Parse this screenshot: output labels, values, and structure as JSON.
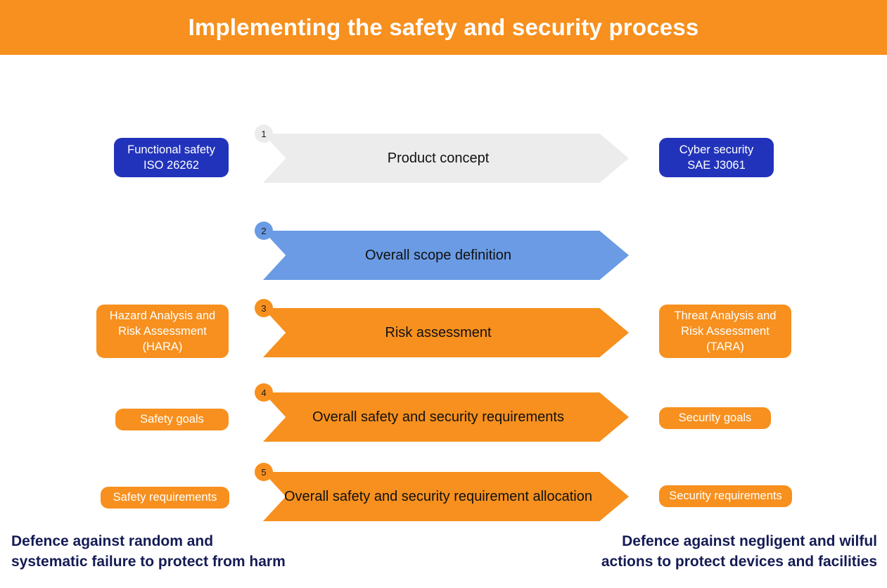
{
  "header": {
    "title": "Implementing the safety and security process",
    "background_color": "#F7901E",
    "text_color": "#FFFFFF"
  },
  "colors": {
    "orange": "#F7901E",
    "navy_blue": "#2233BB",
    "light_blue": "#6A9BE4",
    "light_gray": "#ECECEC",
    "footer_navy": "#141B54",
    "chevron_text": "#111111"
  },
  "process_steps": [
    {
      "number": "1",
      "label": "Product concept",
      "fill": "#ECECEC",
      "badge_fill": "#ECECEC",
      "left_box": null,
      "right_box": null
    },
    {
      "number": "2",
      "label": "Overall scope definition",
      "fill": "#6A9BE4",
      "badge_fill": "#6A9BE4",
      "left_box": null,
      "right_box": null
    },
    {
      "number": "3",
      "label": "Risk assessment",
      "fill": "#F7901E",
      "badge_fill": "#F7901E",
      "left_box": "Hazard Analysis and\nRisk Assessment\n(HARA)",
      "right_box": "Threat Analysis and\nRisk Assessment\n(TARA)"
    },
    {
      "number": "4",
      "label": "Overall safety and security requirements",
      "fill": "#F7901E",
      "badge_fill": "#F7901E",
      "left_box": "Safety goals",
      "right_box": "Security  goals"
    },
    {
      "number": "5",
      "label": "Overall safety and security requirement allocation",
      "fill": "#F7901E",
      "badge_fill": "#F7901E",
      "left_box": "Safety requirements",
      "right_box": "Security  requirements"
    }
  ],
  "standards": {
    "left": "Functional safety\nISO 26262",
    "right": "Cyber security\nSAE J3061"
  },
  "footer": {
    "left_caption": "Defence against random and\nsystematic failure to protect from harm",
    "right_caption": "Defence against negligent and wilful\nactions to protect devices and facilities"
  }
}
